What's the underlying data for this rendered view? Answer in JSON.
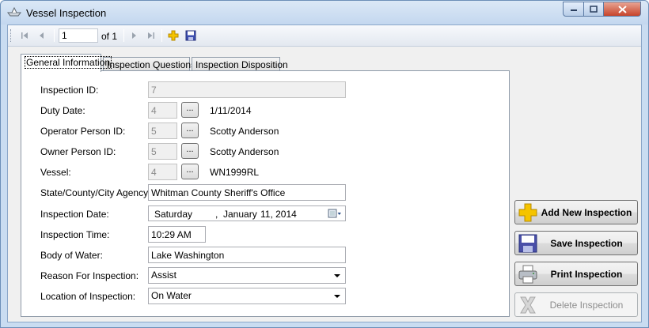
{
  "window": {
    "title": "Vessel Inspection",
    "minimize_icon": "minimize-icon",
    "maximize_icon": "maximize-icon",
    "close_icon": "close-icon"
  },
  "navigator": {
    "position": "1",
    "of_label": "of 1",
    "icons": [
      "first-icon",
      "previous-icon",
      "next-icon",
      "last-icon",
      "add-icon",
      "save-icon"
    ]
  },
  "tabs": [
    {
      "label": "General Information",
      "active": true
    },
    {
      "label": "Inspection Questions",
      "active": false
    },
    {
      "label": "Inspection Disposition",
      "active": false
    }
  ],
  "form": {
    "inspection_id": {
      "label": "Inspection ID:",
      "value": "7"
    },
    "duty_date": {
      "label": "Duty Date:",
      "value": "4",
      "button": "...",
      "display": "1/11/2014"
    },
    "operator": {
      "label": "Operator Person ID:",
      "value": "5",
      "button": "...",
      "display": "Scotty Anderson"
    },
    "owner": {
      "label": "Owner Person ID:",
      "value": "5",
      "button": "...",
      "display": "Scotty Anderson"
    },
    "vessel": {
      "label": "Vessel:",
      "value": "4",
      "button": "...",
      "display": "WN1999RL"
    },
    "agency": {
      "label": "State/County/City Agency:",
      "value": "Whitman County Sheriff's Office"
    },
    "inspection_date": {
      "label": "Inspection Date:",
      "weekday": "Saturday",
      "sep": ",",
      "month": "January",
      "daynum": "11, 2014"
    },
    "inspection_time": {
      "label": "Inspection Time:",
      "value": "10:29 AM"
    },
    "body_of_water": {
      "label": "Body of Water:",
      "value": "Lake Washington"
    },
    "reason": {
      "label": "Reason For Inspection:",
      "value": "Assist"
    },
    "location": {
      "label": "Location of Inspection:",
      "value": "On Water"
    }
  },
  "actions": {
    "add": "Add New Inspection",
    "save": "Save Inspection",
    "print": "Print Inspection",
    "delete": "Delete Inspection"
  },
  "colors": {
    "title_bar": "#c3d7ef",
    "close_button": "#c7432a",
    "add_icon": "#f5c400",
    "save_icon": "#4a4fa8"
  }
}
